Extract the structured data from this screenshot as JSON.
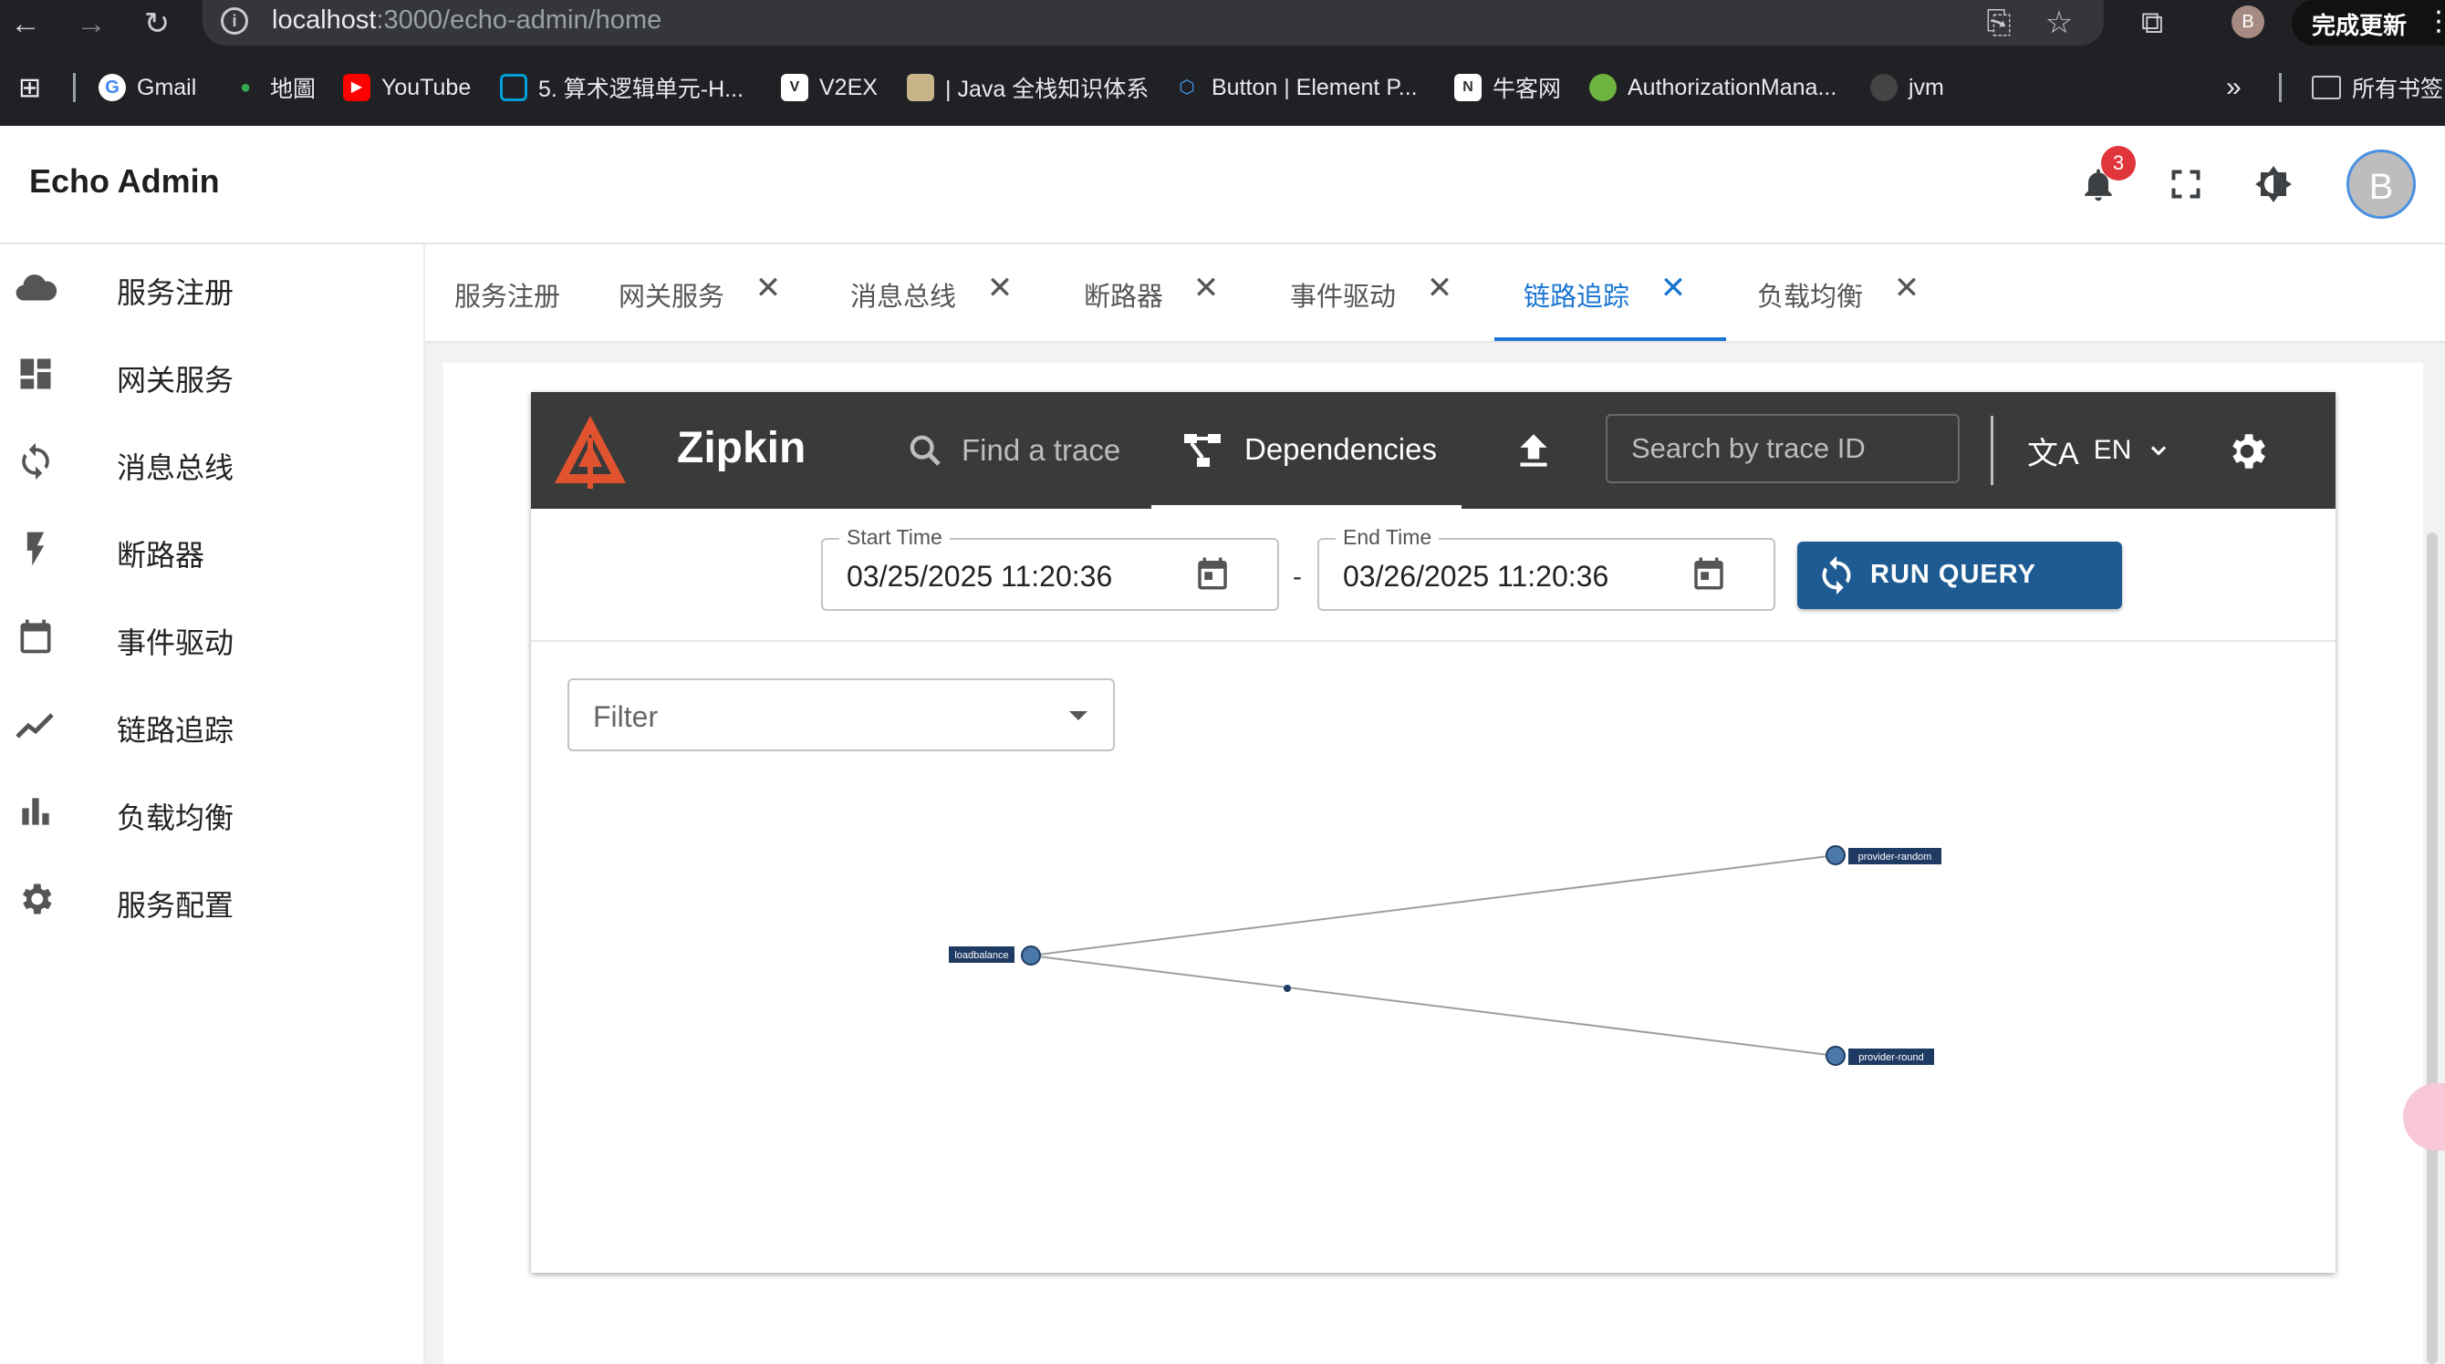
{
  "browser": {
    "url_host": "localhost",
    "url_rest": ":3000/echo-admin/home",
    "profile_initial": "B",
    "update_label": "完成更新",
    "bookmarks": [
      {
        "label": "Gmail",
        "icon": "google-icon"
      },
      {
        "label": "地圖",
        "icon": "maps-pin-icon"
      },
      {
        "label": "YouTube",
        "icon": "youtube-icon"
      },
      {
        "label": "5. 算术逻辑单元-H...",
        "icon": "bilibili-icon"
      },
      {
        "label": "V2EX",
        "icon": "v2ex-icon"
      },
      {
        "label": "| Java 全栈知识体系",
        "icon": "java-icon"
      },
      {
        "label": "Button | Element P...",
        "icon": "element-icon"
      },
      {
        "label": "牛客网",
        "icon": "nowcoder-icon"
      },
      {
        "label": "AuthorizationMana...",
        "icon": "spring-icon"
      },
      {
        "label": "jvm",
        "icon": "github-icon"
      }
    ],
    "more_bookmarks": "»",
    "all_bookmarks": "所有书签"
  },
  "app": {
    "title": "Echo Admin",
    "notification_count": "3",
    "user_initial": "B"
  },
  "sidebar": {
    "items": [
      {
        "label": "服务注册",
        "icon": "cloud-icon"
      },
      {
        "label": "网关服务",
        "icon": "dashboard-icon"
      },
      {
        "label": "消息总线",
        "icon": "sync-icon"
      },
      {
        "label": "断路器",
        "icon": "bolt-icon"
      },
      {
        "label": "事件驱动",
        "icon": "calendar-icon"
      },
      {
        "label": "链路追踪",
        "icon": "trend-icon"
      },
      {
        "label": "负载均衡",
        "icon": "bar-chart-icon"
      },
      {
        "label": "服务配置",
        "icon": "gear-icon"
      }
    ]
  },
  "tabs": [
    {
      "label": "服务注册",
      "closable": false
    },
    {
      "label": "网关服务",
      "closable": true
    },
    {
      "label": "消息总线",
      "closable": true
    },
    {
      "label": "断路器",
      "closable": true
    },
    {
      "label": "事件驱动",
      "closable": true
    },
    {
      "label": "链路追踪",
      "closable": true,
      "active": true
    },
    {
      "label": "负载均衡",
      "closable": true
    }
  ],
  "zipkin": {
    "brand": "Zipkin",
    "find_trace": "Find a trace",
    "dependencies": "Dependencies",
    "search_placeholder": "Search by trace ID",
    "language": "EN",
    "start_time_label": "Start Time",
    "start_time": "03/25/2025 11:20:36",
    "end_time_label": "End Time",
    "end_time": "03/26/2025 11:20:36",
    "date_separator": "-",
    "run_query": "RUN QUERY",
    "filter_placeholder": "Filter",
    "colors": {
      "bar": "#3a3a3a",
      "accent": "#1f5b93",
      "logo": "#e0532e"
    },
    "graph": {
      "nodes": [
        "loadbalance",
        "provider-random",
        "provider-round"
      ],
      "edges": [
        {
          "from": "loadbalance",
          "to": "provider-random"
        },
        {
          "from": "loadbalance",
          "to": "provider-round"
        }
      ]
    }
  }
}
